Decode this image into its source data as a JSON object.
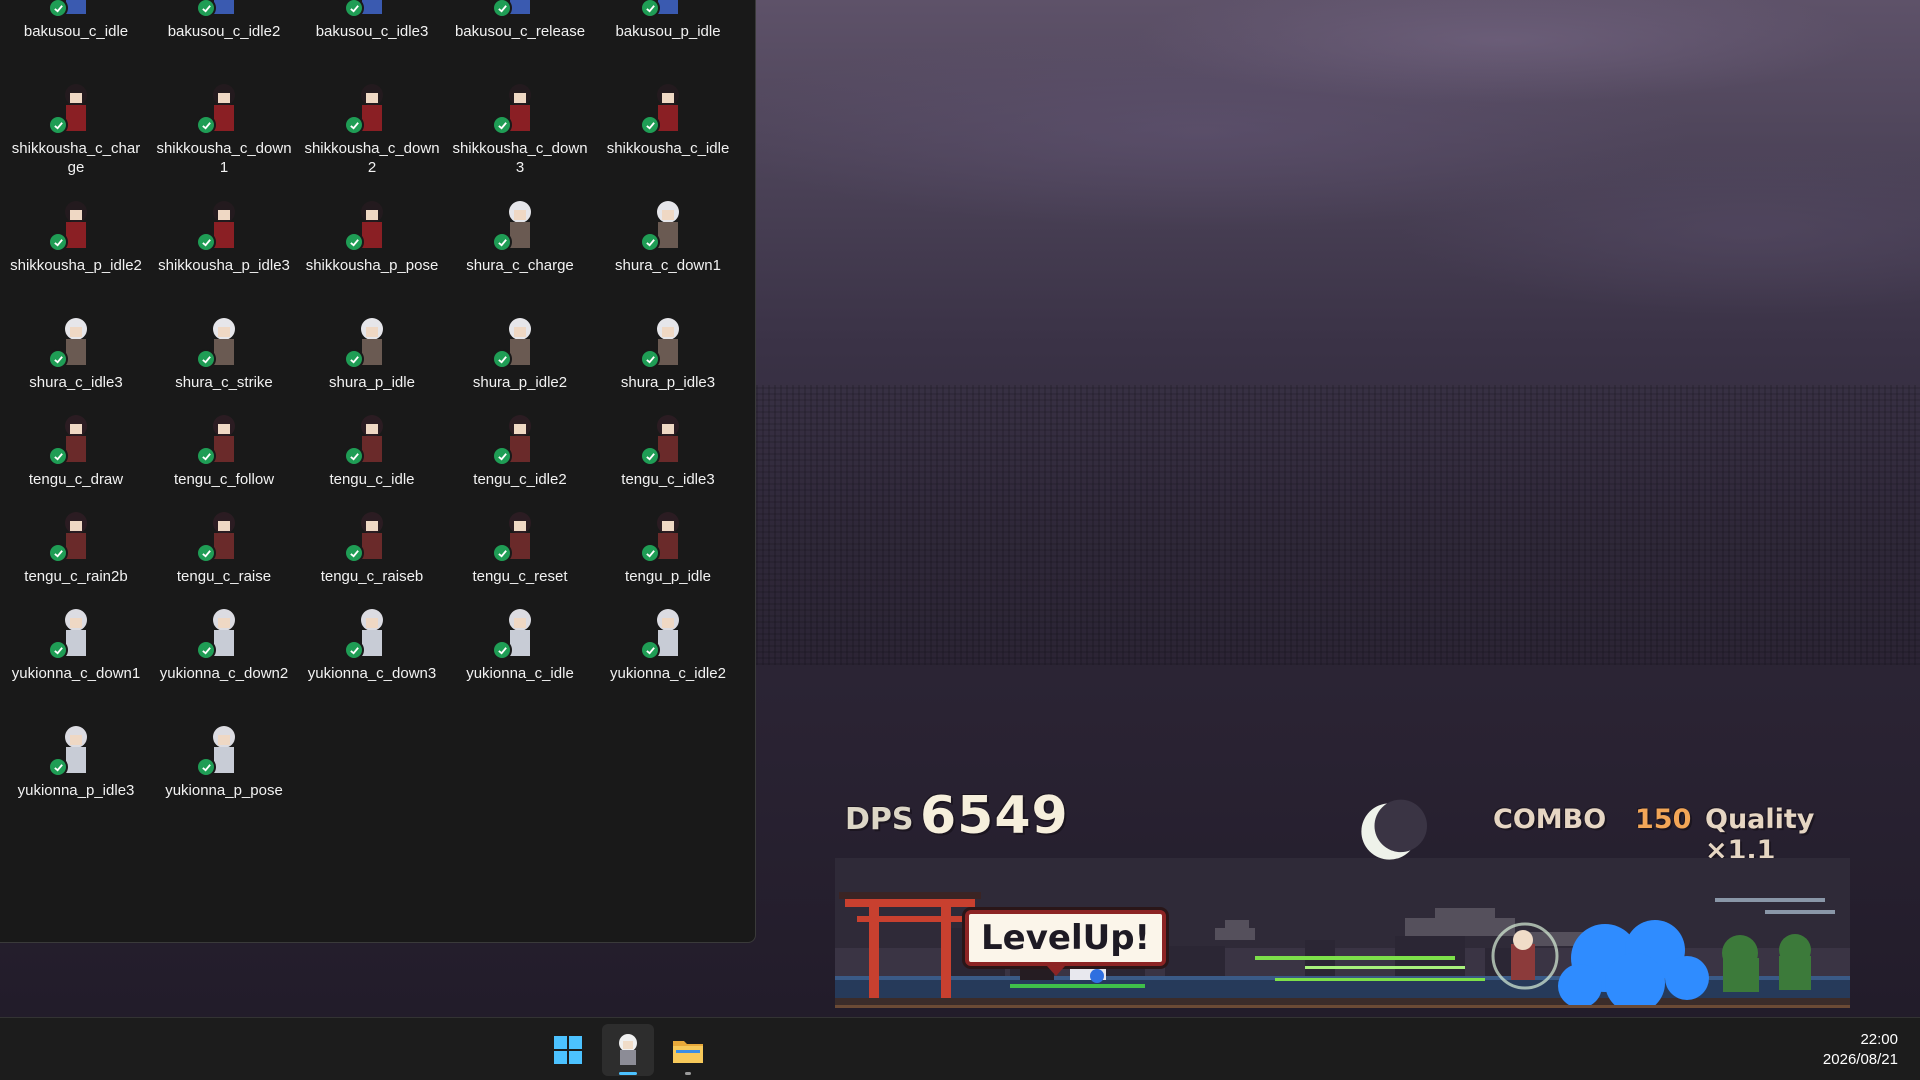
{
  "explorer": {
    "files": [
      "bakusou_c_idle",
      "bakusou_c_idle2",
      "bakusou_c_idle3",
      "bakusou_c_release",
      "bakusou_p_idle",
      "shikkousha_c_charge",
      "shikkousha_c_down1",
      "shikkousha_c_down2",
      "shikkousha_c_down3",
      "shikkousha_c_idle",
      "shikkousha_p_idle2",
      "shikkousha_p_idle3",
      "shikkousha_p_pose",
      "shura_c_charge",
      "shura_c_down1",
      "shura_c_idle3",
      "shura_c_strike",
      "shura_p_idle",
      "shura_p_idle2",
      "shura_p_idle3",
      "tengu_c_draw",
      "tengu_c_follow",
      "tengu_c_idle",
      "tengu_c_idle2",
      "tengu_c_idle3",
      "tengu_c_rain2b",
      "tengu_c_raise",
      "tengu_c_raiseb",
      "tengu_c_reset",
      "tengu_p_idle",
      "yukionna_c_down1",
      "yukionna_c_down2",
      "yukionna_c_down3",
      "yukionna_c_idle",
      "yukionna_c_idle2",
      "yukionna_p_idle3",
      "yukionna_p_pose"
    ],
    "sync_status_icon": "check-circle-icon",
    "sync_color": "#1f9d55"
  },
  "game": {
    "dps_label": "DPS",
    "dps_value": "6549",
    "combo_label": "COMBO",
    "combo_value": "150",
    "quality_label": "Quality ×1.1",
    "popup": "LevelUp!",
    "buttons": {
      "refresh_icon": "refresh-icon",
      "menu_icon": "menu-icon"
    },
    "colors": {
      "combo_value": "#f2a657",
      "refresh_button": "#4da86a",
      "menu_button": "#9c3232"
    }
  },
  "taskbar": {
    "apps": [
      {
        "name": "start-icon"
      },
      {
        "name": "game-app-icon",
        "active": true
      },
      {
        "name": "file-explorer-icon",
        "running": true
      }
    ],
    "accent": "#4cc2ff",
    "time": "22:00",
    "date": "2026/08/21"
  }
}
